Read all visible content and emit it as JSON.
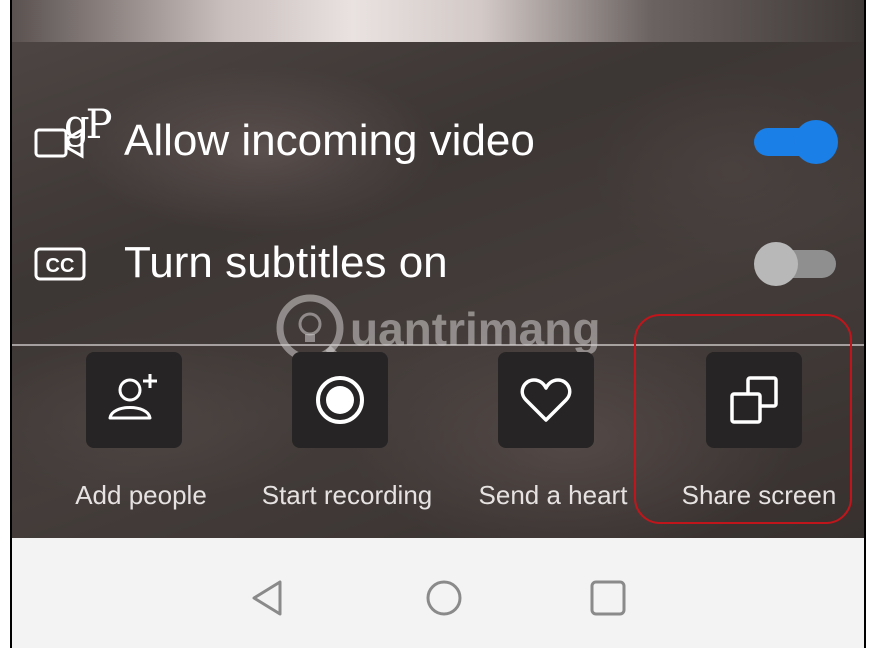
{
  "settings": {
    "incoming_video": {
      "label": "Allow incoming video",
      "icon": "video-camera-icon",
      "overlay_mark": "gP",
      "enabled": true
    },
    "subtitles": {
      "label": "Turn subtitles on",
      "icon": "closed-captions-icon",
      "icon_text": "CC",
      "enabled": false
    }
  },
  "watermark": {
    "text": "uantrimang"
  },
  "actions": [
    {
      "label": "Add people",
      "icon": "add-person-icon"
    },
    {
      "label": "Start recording",
      "icon": "record-icon"
    },
    {
      "label": "Send a heart",
      "icon": "heart-icon"
    },
    {
      "label": "Share screen",
      "icon": "share-screen-icon"
    }
  ],
  "navbar": {
    "buttons": [
      "back-triangle-icon",
      "home-circle-icon",
      "recents-square-icon"
    ]
  },
  "colors": {
    "toggle_on": "#1a7fe6",
    "toggle_off_thumb": "#b8b8b8",
    "highlight": "#c0161b",
    "tile": "#262424"
  }
}
